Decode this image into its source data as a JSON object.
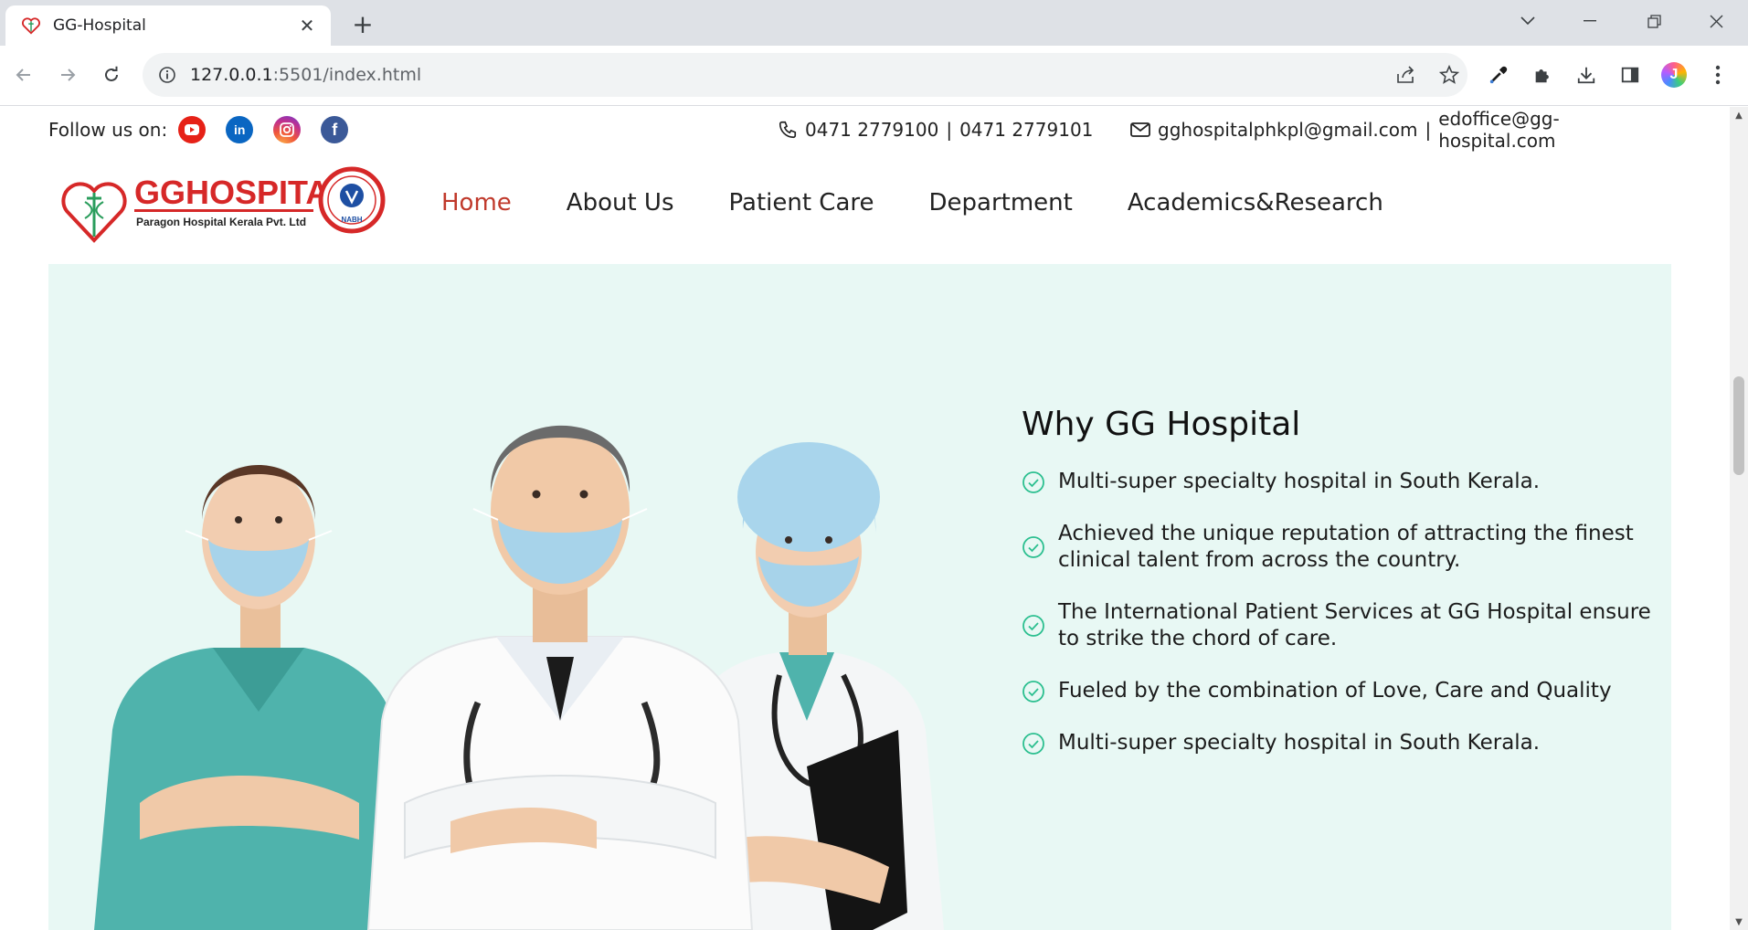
{
  "browser": {
    "tab_title": "GG-Hospital",
    "url_host": "127.0.0.1",
    "url_rest": ":5501/index.html"
  },
  "topbar": {
    "follow_label": "Follow us on:",
    "socials": [
      "youtube-icon",
      "linkedin-icon",
      "instagram-icon",
      "facebook-icon"
    ],
    "phone1": "0471 2779100",
    "phone_sep": "|",
    "phone2": "0471 2779101",
    "email1": "gghospitalphkpl@gmail.com",
    "email_sep": "|",
    "email2": "edoffice@gg-hospital.com"
  },
  "logo": {
    "name": "GGHOSPITAL",
    "sub": "Paragon Hospital Kerala Pvt. Ltd",
    "badge": "NABH"
  },
  "nav": {
    "items": [
      "Home",
      "About Us",
      "Patient Care",
      "Department",
      "Academics&Research"
    ],
    "active": "Home"
  },
  "why": {
    "title": "Why GG Hospital",
    "items": [
      "Multi-super specialty hospital in South Kerala.",
      "Achieved the unique reputation of attracting the finest clinical talent from across the country.",
      "The International Patient Services at GG Hospital ensure to strike the chord of care.",
      "Fueled by the combination of Love, Care and Quality",
      "Multi-super specialty hospital in South Kerala."
    ]
  },
  "colors": {
    "accent_red": "#c0392b",
    "hero_bg": "#e8f8f4",
    "check_green": "#2bbf8f"
  }
}
